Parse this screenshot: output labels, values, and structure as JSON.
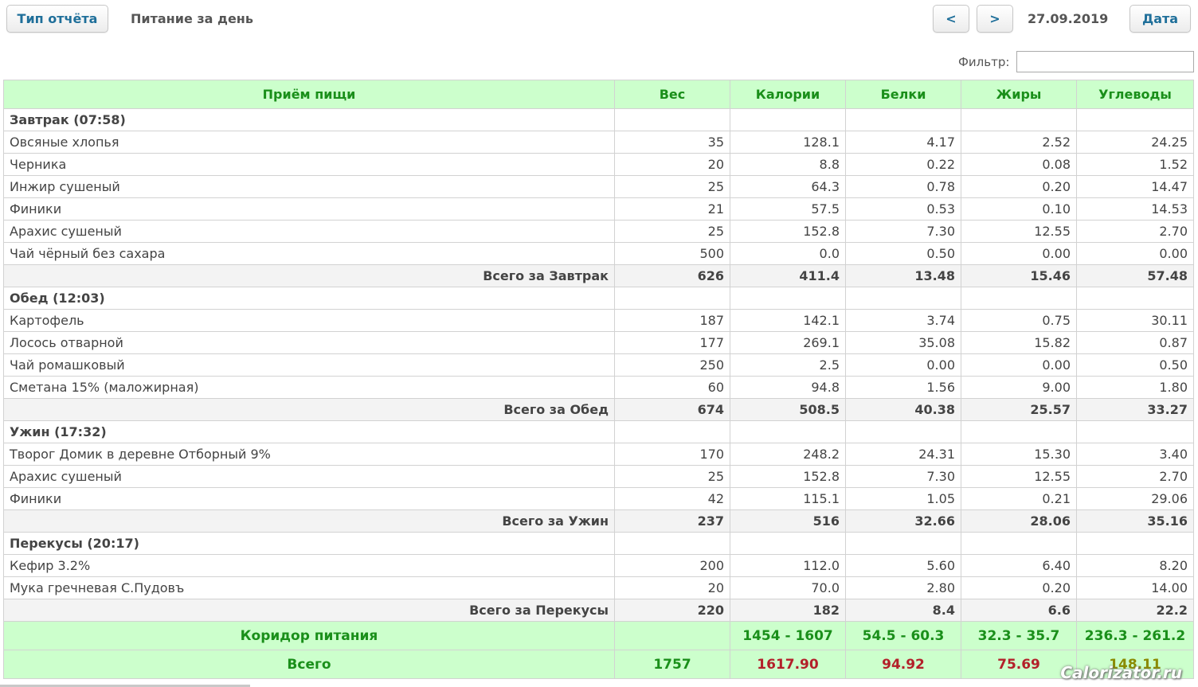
{
  "header": {
    "report_type_label": "Тип отчёта",
    "title": "Питание за день",
    "prev_label": "<",
    "next_label": ">",
    "date": "27.09.2019",
    "date_label": "Дата"
  },
  "filter": {
    "label": "Фильтр:",
    "value": ""
  },
  "table": {
    "columns": [
      "Приём пищи",
      "Вес",
      "Калории",
      "Белки",
      "Жиры",
      "Углеводы"
    ],
    "meals": [
      {
        "title": "Завтрак (07:58)",
        "items": [
          [
            "Овсяные хлопья",
            "35",
            "128.1",
            "4.17",
            "2.52",
            "24.25"
          ],
          [
            "Черника",
            "20",
            "8.8",
            "0.22",
            "0.08",
            "1.52"
          ],
          [
            "Инжир сушеный",
            "25",
            "64.3",
            "0.78",
            "0.20",
            "14.47"
          ],
          [
            "Финики",
            "21",
            "57.5",
            "0.53",
            "0.10",
            "14.53"
          ],
          [
            "Арахис сушеный",
            "25",
            "152.8",
            "7.30",
            "12.55",
            "2.70"
          ],
          [
            "Чай чёрный без сахара",
            "500",
            "0.0",
            "0.50",
            "0.00",
            "0.00"
          ]
        ],
        "subtotal": [
          "Всего за Завтрак",
          "626",
          "411.4",
          "13.48",
          "15.46",
          "57.48"
        ]
      },
      {
        "title": "Обед (12:03)",
        "items": [
          [
            "Картофель",
            "187",
            "142.1",
            "3.74",
            "0.75",
            "30.11"
          ],
          [
            "Лосось отварной",
            "177",
            "269.1",
            "35.08",
            "15.82",
            "0.87"
          ],
          [
            "Чай ромашковый",
            "250",
            "2.5",
            "0.00",
            "0.00",
            "0.50"
          ],
          [
            "Сметана 15% (маложирная)",
            "60",
            "94.8",
            "1.56",
            "9.00",
            "1.80"
          ]
        ],
        "subtotal": [
          "Всего за Обед",
          "674",
          "508.5",
          "40.38",
          "25.57",
          "33.27"
        ]
      },
      {
        "title": "Ужин (17:32)",
        "items": [
          [
            "Творог Домик в деревне Отборный 9%",
            "170",
            "248.2",
            "24.31",
            "15.30",
            "3.40"
          ],
          [
            "Арахис сушеный",
            "25",
            "152.8",
            "7.30",
            "12.55",
            "2.70"
          ],
          [
            "Финики",
            "42",
            "115.1",
            "1.05",
            "0.21",
            "29.06"
          ]
        ],
        "subtotal": [
          "Всего за Ужин",
          "237",
          "516",
          "32.66",
          "28.06",
          "35.16"
        ]
      },
      {
        "title": "Перекусы (20:17)",
        "items": [
          [
            "Кефир 3.2%",
            "200",
            "112.0",
            "5.60",
            "6.40",
            "8.20"
          ],
          [
            "Мука гречневая С.Пудовъ",
            "20",
            "70.0",
            "2.80",
            "0.20",
            "14.00"
          ]
        ],
        "subtotal": [
          "Всего за Перекусы",
          "220",
          "182",
          "8.4",
          "6.6",
          "22.2"
        ]
      }
    ],
    "corridor": [
      "Коридор питания",
      "",
      "1454 - 1607",
      "54.5 - 60.3",
      "32.3 - 35.7",
      "236.3 - 261.2"
    ],
    "total": [
      "Всего",
      "1757",
      "1617.90",
      "94.92",
      "75.69",
      "148.11"
    ],
    "total_colors": [
      "#1a8f1a",
      "#1a8f1a",
      "#b3202a",
      "#b3202a",
      "#b3202a",
      "#8a8a00"
    ]
  },
  "watermark": "Calorizator.ru",
  "colors": {
    "header_bg": "#ccffcc",
    "header_text": "#1a8f1a",
    "subtotal_bg": "#f3f3f3",
    "over_limit": "#b3202a"
  }
}
